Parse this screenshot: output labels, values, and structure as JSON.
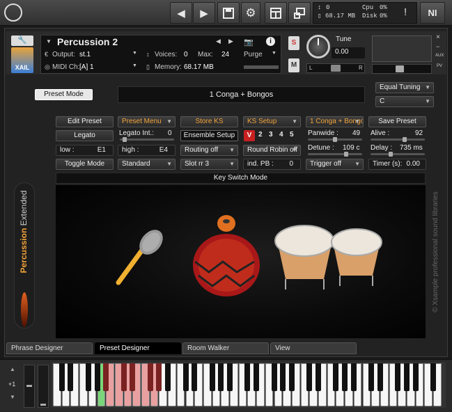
{
  "app": {
    "cpu_label": "Cpu",
    "cpu_value": "0%",
    "disk_label": "Disk",
    "disk_value": "0%",
    "voices_count": "0",
    "memory_total": "68.17 MB",
    "alert_label": "!",
    "ni_logo": "NI"
  },
  "instrument": {
    "name": "Percussion 2",
    "output_label": "Output:",
    "output_value": "st.1",
    "midi_label": "MIDI Ch:",
    "midi_value": "[A]  1",
    "voices_label": "Voices:",
    "voices_value": "0",
    "max_label": "Max:",
    "max_value": "24",
    "memory_label": "Memory:",
    "memory_value": "68.17 MB",
    "purge_label": "Purge",
    "tune_label": "Tune",
    "tune_value": "0.00",
    "s_label": "S",
    "m_label": "M",
    "pan_left": "L",
    "pan_right": "R",
    "aux_label": "AUX",
    "pv_label": "PV",
    "logo_text": "XAIL"
  },
  "main": {
    "preset_mode_label": "Preset Mode",
    "preset_display": "1 Conga + Bongos",
    "tuning_select": "Equal Tuning",
    "key_select": "C",
    "edit_preset": "Edit Preset",
    "preset_menu": "Preset Menu",
    "store_ks": "Store KS",
    "ks_setup": "KS Setup",
    "conga_select": "1 Conga + Bongos",
    "save_preset": "Save Preset",
    "legato": "Legato",
    "legato_int_label": "Legato Int.:",
    "legato_int_value": "0",
    "ensemble_setup": "Ensemble Setup",
    "ens_v": "V",
    "ens_2": "2",
    "ens_3": "3",
    "ens_4": "4",
    "ens_5": "5",
    "panwide_label": "Panwide :",
    "panwide_value": "49",
    "alive_label": "Alive :",
    "alive_value": "92",
    "low_label": "low :",
    "low_value": "E1",
    "high_label": "high :",
    "high_value": "E4",
    "routing": "Routing off",
    "round_robin": "Round Robin off",
    "detune_label": "Detune :",
    "detune_value": "109 c",
    "delay_label": "Delay :",
    "delay_value": "735 ms",
    "toggle_mode": "Toggle Mode",
    "standard": "Standard",
    "slot": "Slot rr 3",
    "ind_pb_label": "ind. PB :",
    "ind_pb_value": "0",
    "trigger": "Trigger off",
    "timer_label": "Timer (s):",
    "timer_value": "0.00",
    "key_switch_mode": "Key Switch Mode",
    "side_title_a": "Percussion",
    "side_title_b": "Extended",
    "brand_text": "© Xsample professional sound libraries"
  },
  "tabs": [
    "Phrase Designer",
    "Preset Designer",
    "Room Walker",
    "View"
  ],
  "keyboard": {
    "octave_label": "+1"
  },
  "colors": {
    "accent": "#f0a23a",
    "keyswitch_red": "#d86060",
    "keyswitch_green": "#7ad67a",
    "panel_bg": "#222222"
  }
}
